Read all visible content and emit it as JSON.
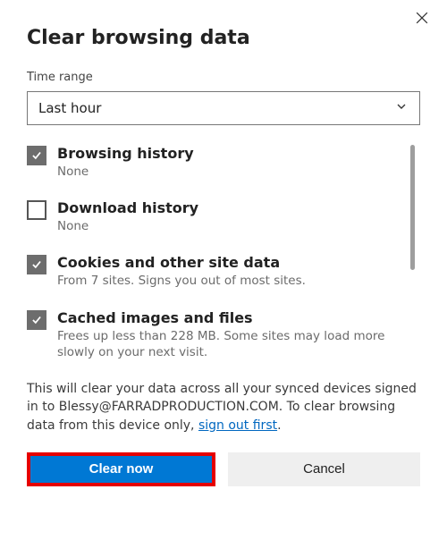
{
  "dialog": {
    "title": "Clear browsing data",
    "time_range_label": "Time range",
    "time_range_value": "Last hour"
  },
  "options": {
    "browsing_history": {
      "title": "Browsing history",
      "subtitle": "None",
      "checked": true
    },
    "download_history": {
      "title": "Download history",
      "subtitle": "None",
      "checked": false
    },
    "cookies": {
      "title": "Cookies and other site data",
      "subtitle": "From 7 sites. Signs you out of most sites.",
      "checked": true
    },
    "cache": {
      "title": "Cached images and files",
      "subtitle": "Frees up less than 228 MB. Some sites may load more slowly on your next visit.",
      "checked": true
    }
  },
  "info": {
    "prefix": "This will clear your data across all your synced devices signed in to Blessy@FARRADPRODUCTION.COM. To clear browsing data from this device only, ",
    "link": "sign out first",
    "suffix": "."
  },
  "buttons": {
    "primary": "Clear now",
    "secondary": "Cancel"
  }
}
